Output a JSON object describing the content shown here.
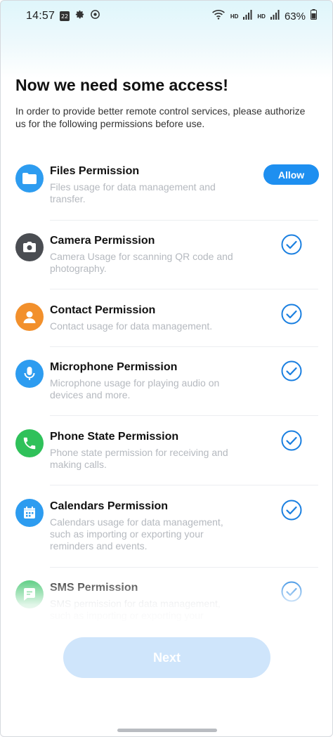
{
  "status_bar": {
    "time": "14:57",
    "calendar_day": "22",
    "network_label_1": "HD",
    "network_label_2": "HD",
    "battery": "63%"
  },
  "header": {
    "title": "Now we need some access!",
    "subtitle": "In order to provide better remote control services, please authorize us for the following permissions before use."
  },
  "permissions": [
    {
      "title": "Files Permission",
      "description": "Files usage for data management and transfer.",
      "icon": "folder-icon",
      "status": "allow-button",
      "color": "#2d9cf0"
    },
    {
      "title": "Camera Permission",
      "description": "Camera Usage for scanning QR code and photography.",
      "icon": "camera-icon",
      "status": "granted",
      "color": "#4a4d52"
    },
    {
      "title": "Contact Permission",
      "description": "Contact usage for data management.",
      "icon": "contact-icon",
      "status": "granted",
      "color": "#f2902c"
    },
    {
      "title": "Microphone Permission",
      "description": "Microphone usage for playing audio on devices and more.",
      "icon": "microphone-icon",
      "status": "granted",
      "color": "#2d9cf0"
    },
    {
      "title": "Phone State Permission",
      "description": "Phone state permission for receiving and making calls.",
      "icon": "phone-icon",
      "status": "granted",
      "color": "#2fc15a"
    },
    {
      "title": "Calendars Permission",
      "description": "Calendars usage for data management, such as importing or exporting your reminders and events.",
      "icon": "calendar-icon",
      "status": "granted",
      "color": "#2d9cf0"
    },
    {
      "title": "SMS Permission",
      "description": "SMS permission for data management, such as importing or exporting your",
      "icon": "sms-icon",
      "status": "granted",
      "color": "#3cc46a"
    }
  ],
  "buttons": {
    "allow": "Allow",
    "next": "Next"
  },
  "colors": {
    "accent": "#1e8ff0",
    "check": "#1a7fe0",
    "next_disabled": "#cfe5fb"
  }
}
